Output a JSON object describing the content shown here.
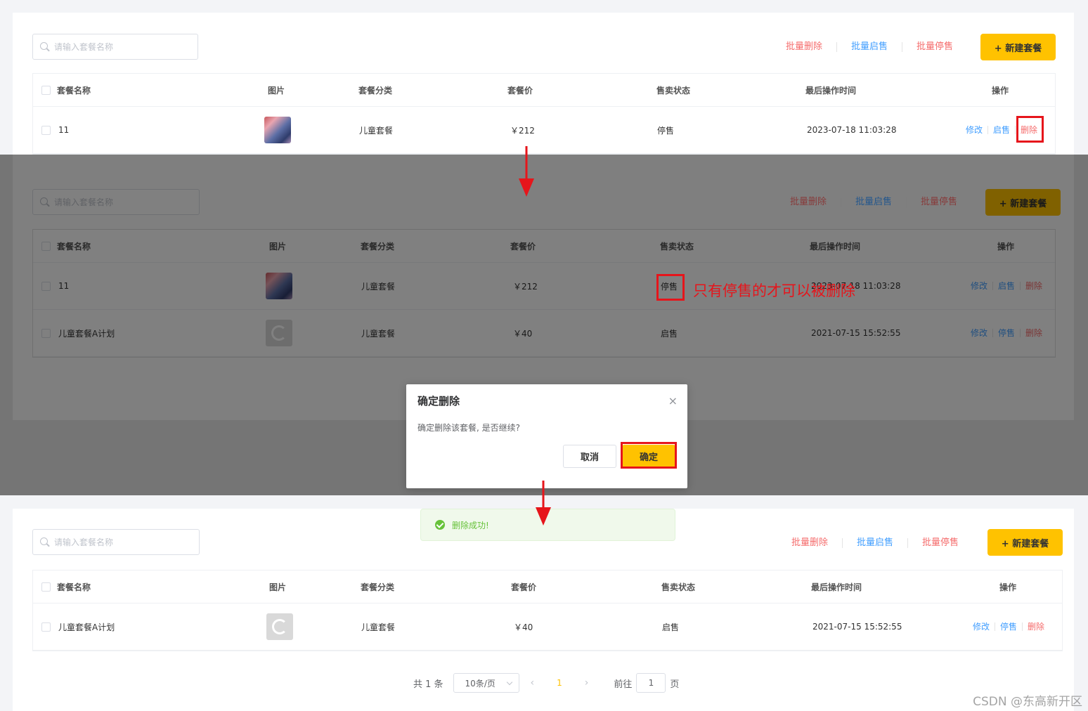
{
  "search": {
    "placeholder": "请输入套餐名称"
  },
  "toolbar": {
    "batch_delete": "批量删除",
    "batch_enable": "批量启售",
    "batch_disable": "批量停售",
    "new_package": "+ 新建套餐"
  },
  "table": {
    "headers": {
      "name": "套餐名称",
      "image": "图片",
      "category": "套餐分类",
      "price": "套餐价",
      "status": "售卖状态",
      "updated": "最后操作时间",
      "actions": "操作"
    },
    "row_a": {
      "name": "11",
      "category": "儿童套餐",
      "price": "￥212",
      "status": "停售",
      "updated": "2023-07-18 11:03:28",
      "edit": "修改",
      "toggle": "启售",
      "delete": "删除"
    },
    "row_b": {
      "name": "儿童套餐A计划",
      "category": "儿童套餐",
      "price": "￥40",
      "status": "启售",
      "updated": "2021-07-15 15:52:55",
      "edit": "修改",
      "toggle": "停售",
      "delete": "删除"
    }
  },
  "dialog": {
    "title": "确定删除",
    "close": "×",
    "message": "确定删除该套餐, 是否继续?",
    "cancel": "取消",
    "confirm": "确定"
  },
  "toast": {
    "message": "删除成功!"
  },
  "annotation": "只有停售的才可以被删除",
  "pagination": {
    "total": "共 1 条",
    "page_size": "10条/页",
    "prev": "‹",
    "current": "1",
    "next": "›",
    "goto_label": "前往",
    "goto_value": "1",
    "page_label": "页"
  },
  "watermark": "CSDN @东高新开区",
  "colors": {
    "accent": "#ffc200",
    "danger": "#f56c6c",
    "link": "#419eff",
    "annotation": "#e6151b",
    "success": "#67c23a"
  }
}
